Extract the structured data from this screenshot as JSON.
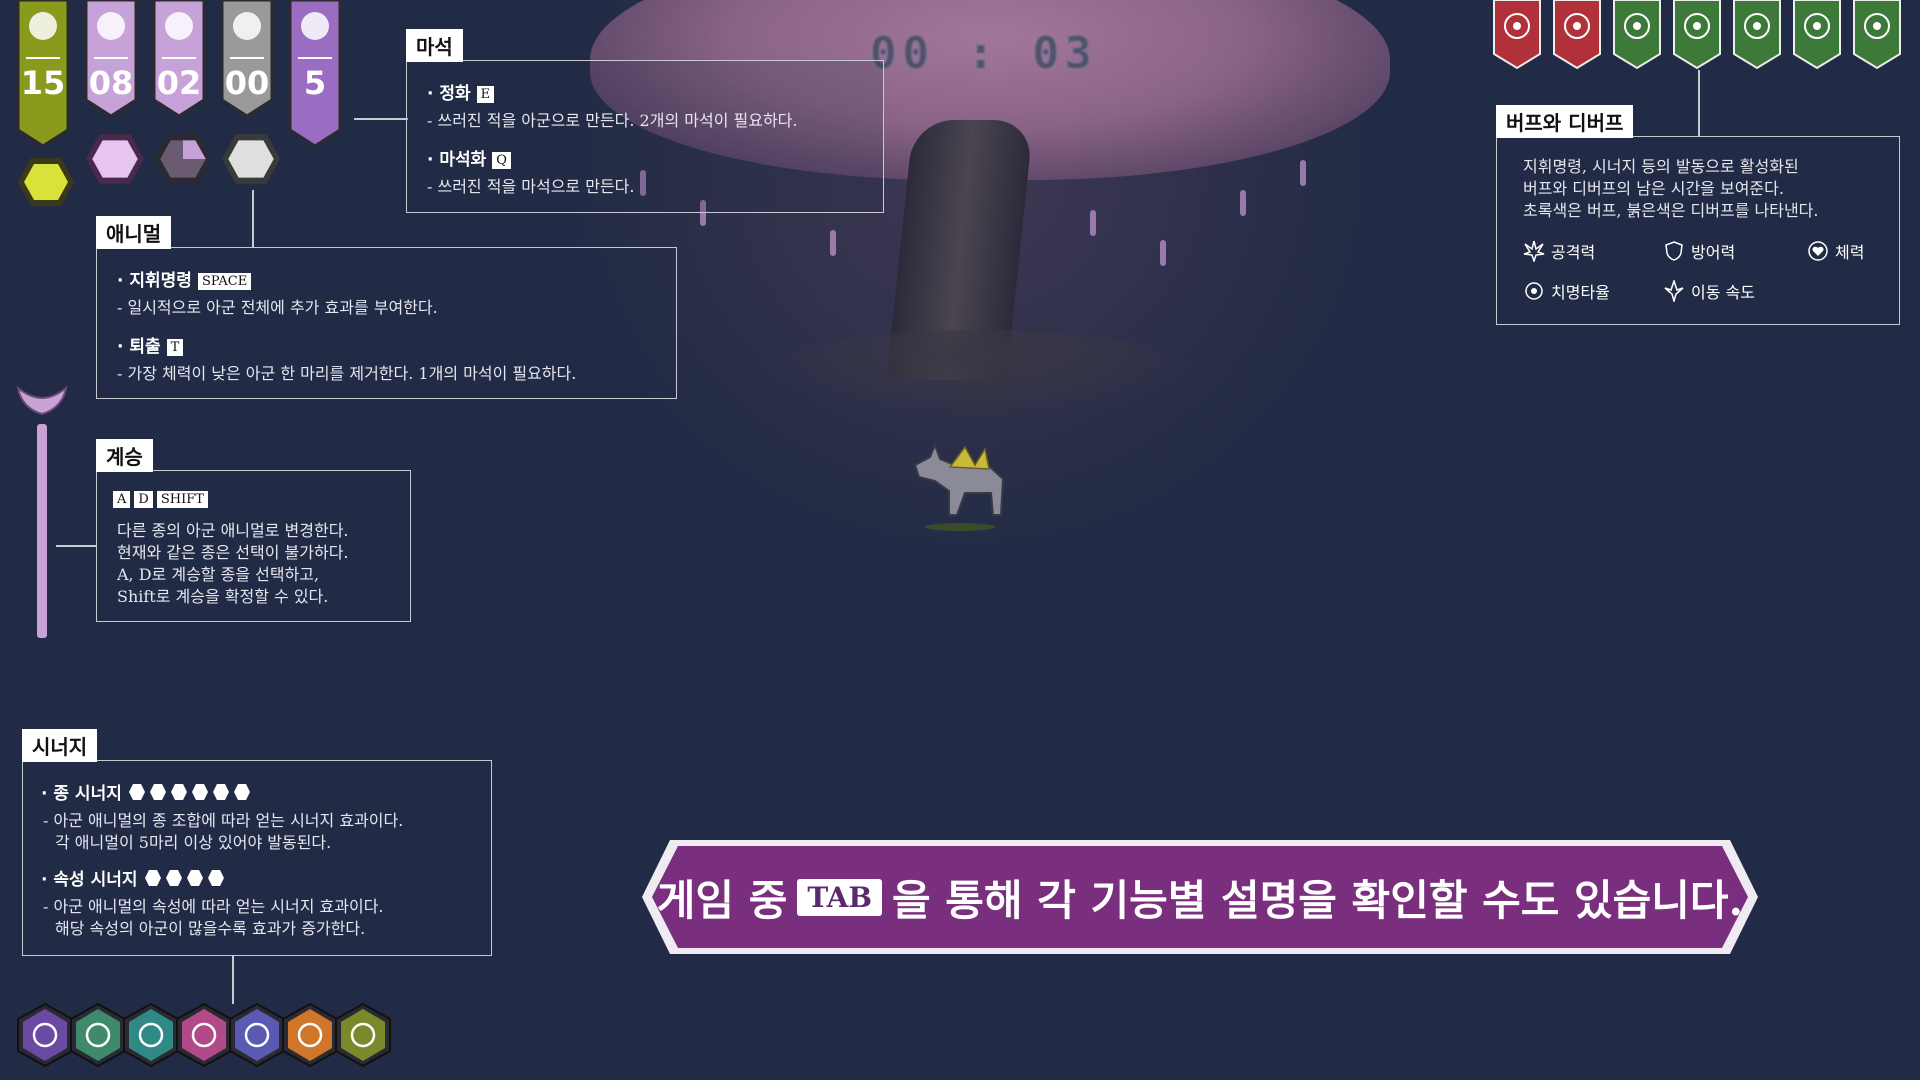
{
  "timer": "00 : 03",
  "banners": [
    {
      "name": "gold-banner",
      "value": "15",
      "color": "#8a9a1c"
    },
    {
      "name": "pink-banner-1",
      "value": "08",
      "color": "#c7a2d9"
    },
    {
      "name": "pink-banner-2",
      "value": "02",
      "color": "#c7a2d9"
    },
    {
      "name": "gray-banner",
      "value": "00",
      "color": "#9a9a9a"
    },
    {
      "name": "purple-banner",
      "value": "5",
      "color": "#9a6cc2"
    }
  ],
  "mana_stone": {
    "title": "마석",
    "item1_label": "· 정화",
    "item1_key": "E",
    "item1_desc": "- 쓰러진 적을 아군으로 만든다. 2개의 마석이 필요하다.",
    "item2_label": "· 마석화",
    "item2_key": "Q",
    "item2_desc": "- 쓰러진 적을 마석으로 만든다."
  },
  "animal": {
    "title": "애니멀",
    "item1_label": "· 지휘명령",
    "item1_key": "SPACE",
    "item1_desc": "- 일시적으로 아군 전체에 추가 효과를 부여한다.",
    "item2_label": "· 퇴출",
    "item2_key": "T",
    "item2_desc": "- 가장 체력이 낮은 아군 한 마리를 제거한다. 1개의 마석이 필요하다."
  },
  "inherit": {
    "title": "계승",
    "keys": [
      "A",
      "D",
      "SHIFT"
    ],
    "lines": [
      "다른 종의 아군 애니멀로 변경한다.",
      "현재와 같은 종은 선택이 불가하다.",
      "A, D로 계승할 종을 선택하고,",
      "Shift로 계승을 확정할 수 있다."
    ]
  },
  "synergy": {
    "title": "시너지",
    "item1_label": "· 종 시너지",
    "item1_desc1": "- 아군 애니멀의 종 조합에 따라 얻는 시너지 효과이다.",
    "item1_desc2": "각 애니멀이 5마리 이상 있어야 발동된다.",
    "item2_label": "· 속성 시너지",
    "item2_desc1": "- 아군 애니멀의 속성에 따라 얻는 시너지 효과이다.",
    "item2_desc2": "해당 속성의 아군이 많을수록 효과가 증가한다."
  },
  "buffs": {
    "title": "버프와 디버프",
    "lines": [
      "지휘명령, 시너지 등의 발동으로 활성화된",
      "버프와 디버프의 남은 시간을 보여준다.",
      "초록색은 버프, 붉은색은 디버프를 나타낸다."
    ],
    "legend": [
      "공격력",
      "방어력",
      "체력",
      "치명타율",
      "이동 속도"
    ],
    "icons": [
      {
        "icon": "crit-icon",
        "color": "#b0313a"
      },
      {
        "icon": "attack-icon",
        "color": "#b0313a"
      },
      {
        "icon": "attack-icon",
        "color": "#3d7a3a"
      },
      {
        "icon": "crit-icon",
        "color": "#3d7a3a"
      },
      {
        "icon": "speed-icon",
        "color": "#3d7a3a"
      },
      {
        "icon": "health-icon",
        "color": "#3d7a3a"
      },
      {
        "icon": "defense-icon",
        "color": "#3d7a3a"
      }
    ]
  },
  "tab_hint": {
    "before": "게임 중",
    "key": "TAB",
    "after": "을 통해 각 기능별 설명을 확인할 수도 있습니다."
  },
  "synergy_hexes": [
    {
      "icon": "dna-icon",
      "color": "#6a4aa3"
    },
    {
      "icon": "eye-icon",
      "color": "#3f8a6c"
    },
    {
      "icon": "target-icon",
      "color": "#2f8a86"
    },
    {
      "icon": "fang-icon",
      "color": "#b24a8a"
    },
    {
      "icon": "spiral-icon",
      "color": "#5a5ab3"
    },
    {
      "icon": "flame-icon",
      "color": "#d0762a"
    },
    {
      "icon": "leaf-icon",
      "color": "#7a8a2a"
    }
  ]
}
